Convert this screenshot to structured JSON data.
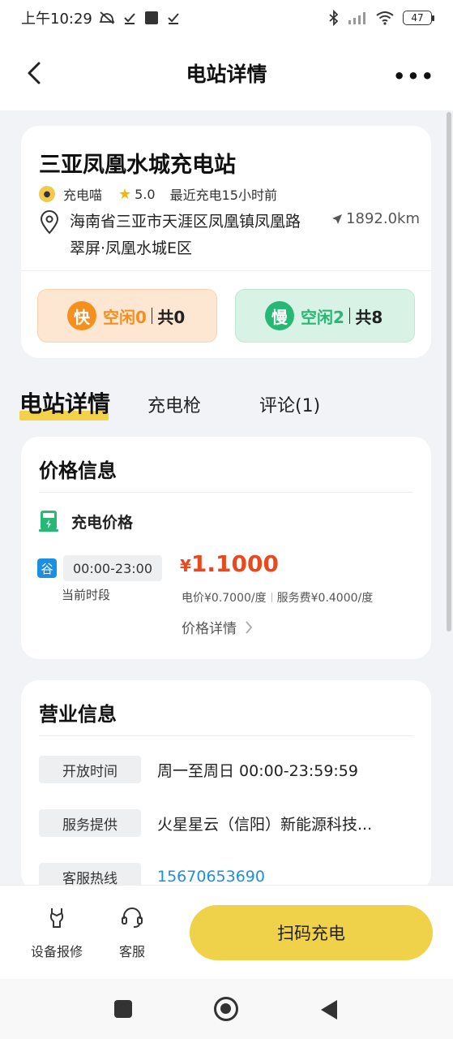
{
  "status_bar": {
    "time": "上午10:29",
    "battery": "47",
    "icons": [
      "mute-icon",
      "check-icon",
      "square-icon",
      "check-icon",
      "bluetooth-icon",
      "signal-icon",
      "wifi-icon"
    ]
  },
  "nav": {
    "title": "电站详情",
    "back_icon": "chevron-left-icon",
    "more_label": "•••"
  },
  "station": {
    "name": "三亚凤凰水城充电站",
    "brand": "充电喵",
    "rating": "5.0",
    "recent": "最近充电15小时前",
    "address": "海南省三亚市天涯区凤凰镇凤凰路翠屏·凤凰水城E区",
    "distance": "1892.0km"
  },
  "fast": {
    "badge": "快",
    "free": "空闲0",
    "total": "共0",
    "color": "#f5901f"
  },
  "slow": {
    "badge": "慢",
    "free": "空闲2",
    "total": "共8",
    "color": "#26b874"
  },
  "tabs": [
    {
      "label": "电站详情",
      "active": true
    },
    {
      "label": "充电枪"
    },
    {
      "label": "评论(1)"
    }
  ],
  "price_info": {
    "title": "价格信息",
    "charge_label": "充电价格",
    "period_tag": "谷",
    "period": "00:00-23:00",
    "current_period": "当前时段",
    "price_symbol": "¥",
    "price": "1.1000",
    "electric": "电价¥0.7000/度",
    "service": "服务费¥0.4000/度",
    "detail_link": "价格详情"
  },
  "business": {
    "title": "营业信息",
    "rows": [
      {
        "label": "开放时间",
        "value": "周一至周日 00:00-23:59:59"
      },
      {
        "label": "服务提供",
        "value": "火星星云（信阳）新能源科技..."
      },
      {
        "label": "客服热线",
        "value": "15670653690"
      }
    ]
  },
  "bottom": {
    "repair": "设备报修",
    "service": "客服",
    "scan": "扫码充电"
  },
  "colors": {
    "accent": "#f0d14a",
    "price": "#e8491d",
    "link": "#1d8fe0"
  }
}
